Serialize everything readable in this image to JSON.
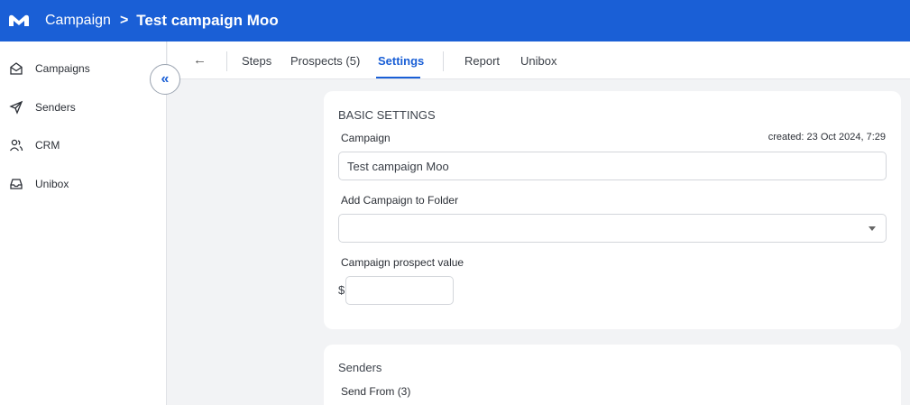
{
  "header": {
    "breadcrumb_root": "Campaign",
    "separator": ">",
    "campaign_title": "Test campaign Moo"
  },
  "sidebar": {
    "items": [
      {
        "label": "Campaigns",
        "icon": "envelope-open-icon"
      },
      {
        "label": "Senders",
        "icon": "paper-plane-icon"
      },
      {
        "label": "CRM",
        "icon": "users-icon"
      },
      {
        "label": "Unibox",
        "icon": "inbox-icon"
      }
    ],
    "collapse_icon": "«"
  },
  "tabs": {
    "back": "←",
    "items": [
      "Steps",
      "Prospects (5)",
      "Settings",
      "Report",
      "Unibox"
    ],
    "active": "Settings"
  },
  "basic_settings": {
    "title": "BASIC SETTINGS",
    "campaign_label": "Campaign",
    "created": "created: 23 Oct 2024, 7:29",
    "campaign_value": "Test campaign Moo",
    "folder_label": "Add Campaign to Folder",
    "folder_value": "",
    "prospect_value_label": "Campaign prospect value",
    "currency": "$",
    "prospect_value": ""
  },
  "senders": {
    "title": "Senders",
    "send_from_label": "Send From (3)"
  },
  "colors": {
    "brand": "#1a5fd6",
    "background": "#f2f3f5"
  }
}
